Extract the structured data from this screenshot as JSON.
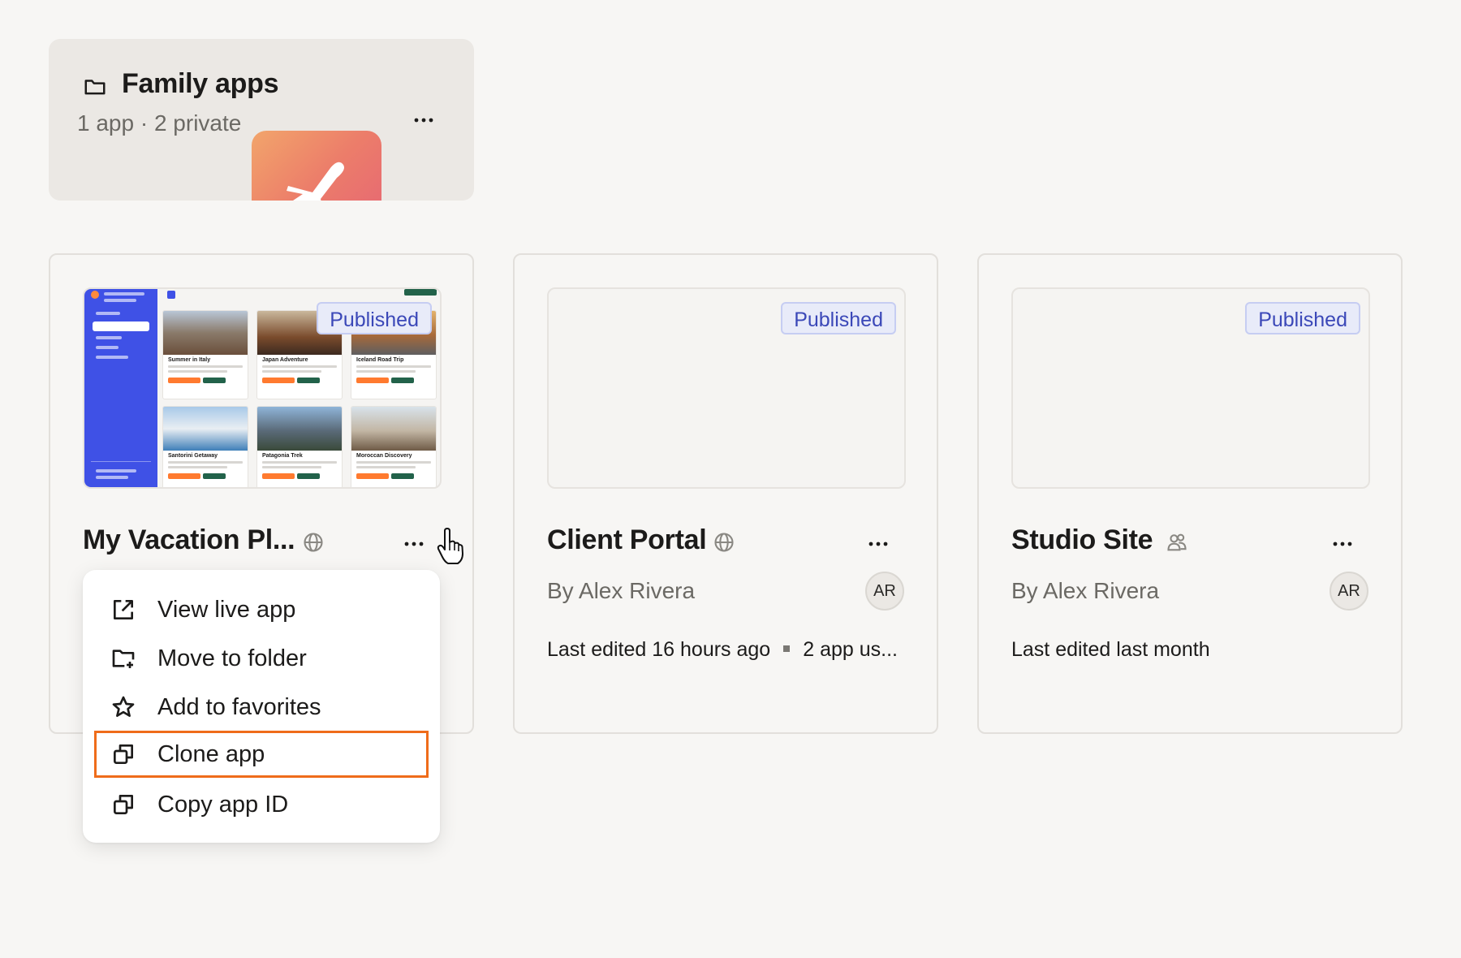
{
  "folder": {
    "title": "Family apps",
    "subtitle": "1 app · 2 private",
    "icon": "folder-icon",
    "thumb_icon": "airplane-icon"
  },
  "apps": [
    {
      "title": "My Vacation Pl...",
      "badge": "Published",
      "visibility_icon": "globe-icon",
      "preview": {
        "tiles": [
          "Summer in Italy",
          "Japan Adventure",
          "Iceland Road Trip",
          "Santorini Getaway",
          "Patagonia Trek",
          "Moroccan Discovery"
        ]
      }
    },
    {
      "title": "Client Portal",
      "badge": "Published",
      "visibility_icon": "globe-icon",
      "by": "By Alex Rivera",
      "avatar": "AR",
      "last_edited": "Last edited 16 hours ago",
      "usage": "2 app us..."
    },
    {
      "title": "Studio Site",
      "badge": "Published",
      "visibility_icon": "users-icon",
      "by": "By Alex Rivera",
      "avatar": "AR",
      "last_edited": "Last edited last month"
    }
  ],
  "menu": {
    "items": [
      {
        "label": "View live app",
        "icon": "external-link-icon"
      },
      {
        "label": "Move to folder",
        "icon": "folder-move-icon"
      },
      {
        "label": "Add to favorites",
        "icon": "star-icon"
      },
      {
        "label": "Clone app",
        "icon": "copy-icon"
      },
      {
        "label": "Copy app ID",
        "icon": "copy-icon"
      }
    ],
    "highlight_color": "#ef6c1a"
  },
  "colors": {
    "accent_blue": "#3f51e6",
    "badge_text": "#3b48b8",
    "background": "#f7f6f4"
  }
}
